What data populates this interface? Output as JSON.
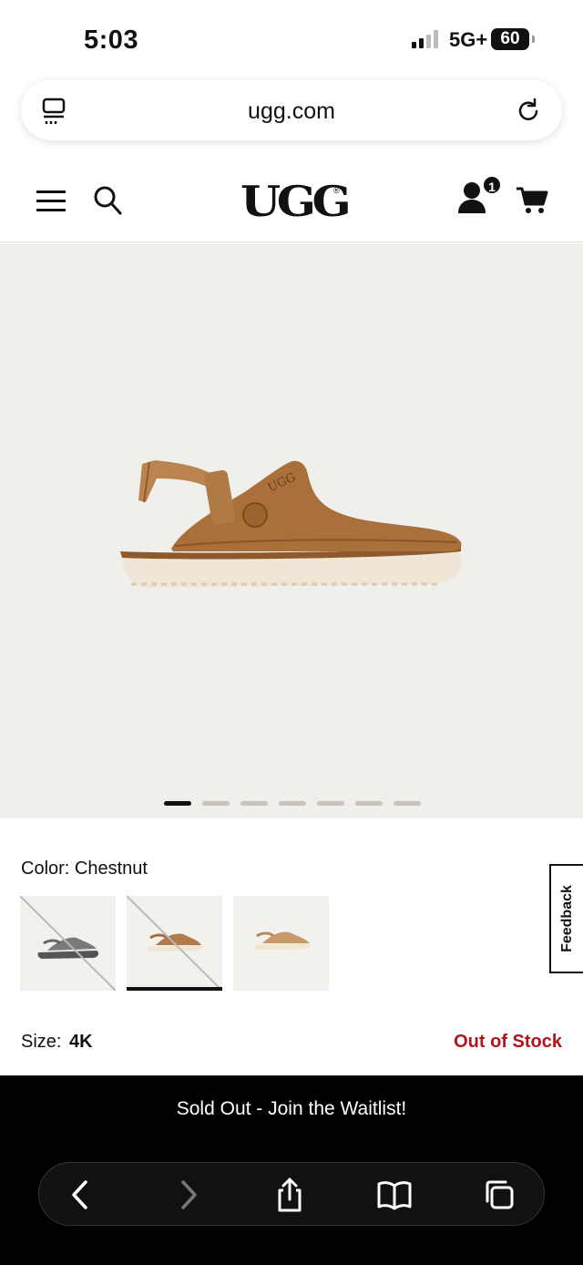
{
  "status_bar": {
    "time": "5:03",
    "network": "5G+",
    "battery": "60"
  },
  "browser": {
    "url": "ugg.com"
  },
  "header": {
    "logo": "UGG",
    "logo_tm": "®",
    "account_badge": "1"
  },
  "gallery": {
    "slide_count": 7,
    "active_slide": 1
  },
  "product": {
    "color_label": "Color:",
    "color_value": "Chestnut",
    "swatches": [
      {
        "name": "Grey",
        "available": false,
        "selected": false,
        "color": "#6b6b6b"
      },
      {
        "name": "Chestnut",
        "available": false,
        "selected": true,
        "color": "#b07a4a"
      },
      {
        "name": "Sand",
        "available": true,
        "selected": false,
        "color": "#c79a6a"
      }
    ],
    "size_label": "Size:",
    "size_value": "4K",
    "stock_status": "Out of Stock"
  },
  "feedback": {
    "label": "Feedback"
  },
  "cta": {
    "label": "Sold Out - Join the Waitlist!"
  },
  "colors": {
    "accent_red": "#b3141c",
    "shoe_brown": "#a9703c",
    "sole_cream": "#efe6d6"
  }
}
